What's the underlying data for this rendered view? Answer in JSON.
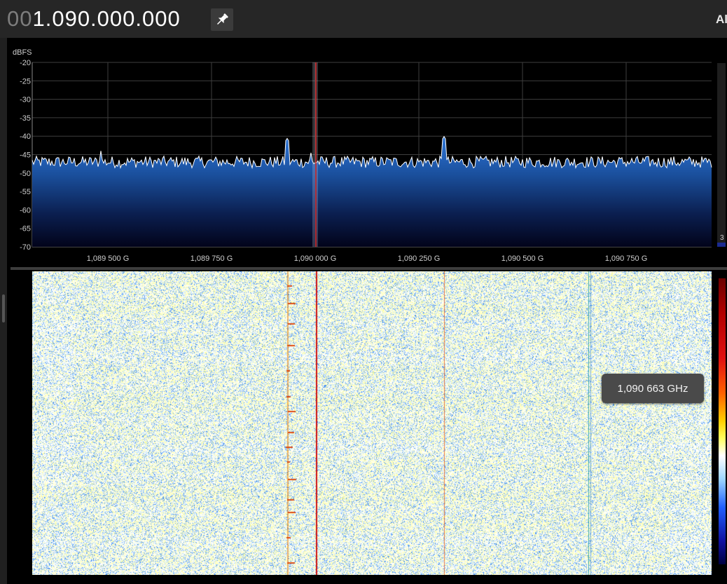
{
  "frequency": {
    "leading": "00",
    "value": "1.090.000.000"
  },
  "corner_label": "Al",
  "spectrum": {
    "unit_label": "dBFS",
    "y_ticks": [
      "-20",
      "-25",
      "-30",
      "-35",
      "-40",
      "-45",
      "-50",
      "-55",
      "-60",
      "-65",
      "-70"
    ],
    "x_ticks": [
      "1,089 500 G",
      "1,089 750 G",
      "1,090 000 G",
      "1,090 250 G",
      "1,090 500 G",
      "1,090 750 G"
    ],
    "side_value": "3"
  },
  "tooltip": {
    "text": "1,090 663 GHz"
  },
  "icons": {
    "pin": "pin-icon"
  },
  "colors": {
    "trace": "#ffffff",
    "fill_top": "#2a6fcf",
    "fill_bottom": "#02031a",
    "center_marker": "#d02020",
    "grid": "#4a4a4a"
  }
}
